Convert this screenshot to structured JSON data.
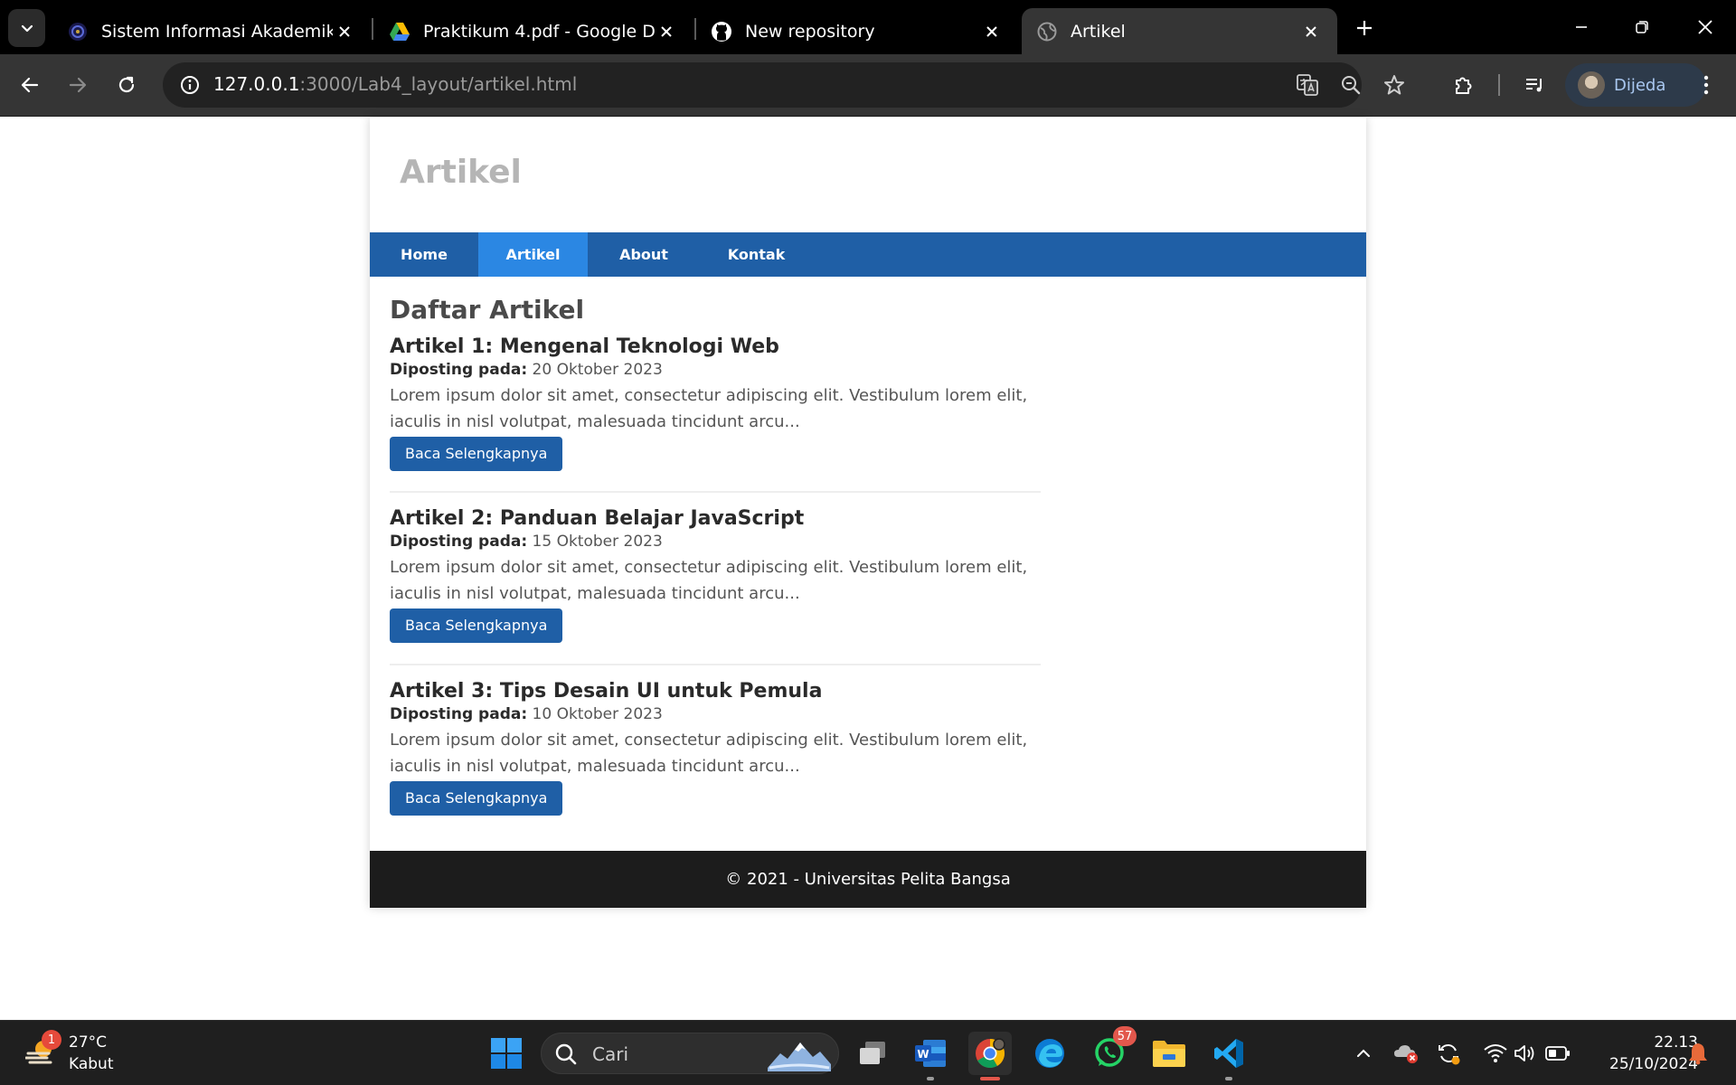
{
  "browser": {
    "tabs": [
      {
        "title": "Sistem Informasi Akademik",
        "active": false
      },
      {
        "title": "Praktikum 4.pdf - Google Drive",
        "active": false
      },
      {
        "title": "New repository",
        "active": false
      },
      {
        "title": "Artikel",
        "active": true
      }
    ],
    "url_host": "127.0.0.1",
    "url_rest": ":3000/Lab4_layout/artikel.html",
    "profile_name": "Dijeda"
  },
  "site": {
    "title": "Artikel",
    "nav": [
      {
        "label": "Home",
        "active": false
      },
      {
        "label": "Artikel",
        "active": true
      },
      {
        "label": "About",
        "active": false
      },
      {
        "label": "Kontak",
        "active": false
      }
    ],
    "content_title": "Daftar Artikel",
    "date_label": "Diposting pada:",
    "articles": [
      {
        "title": "Artikel 1: Mengenal Teknologi Web",
        "date": "20 Oktober 2023",
        "excerpt": "Lorem ipsum dolor sit amet, consectetur adipiscing elit. Vestibulum lorem elit, iaculis in nisl volutpat, malesuada tincidunt arcu...",
        "button": "Baca Selengkapnya"
      },
      {
        "title": "Artikel 2: Panduan Belajar JavaScript",
        "date": "15 Oktober 2023",
        "excerpt": "Lorem ipsum dolor sit amet, consectetur adipiscing elit. Vestibulum lorem elit, iaculis in nisl volutpat, malesuada tincidunt arcu...",
        "button": "Baca Selengkapnya"
      },
      {
        "title": "Artikel 3: Tips Desain UI untuk Pemula",
        "date": "10 Oktober 2023",
        "excerpt": "Lorem ipsum dolor sit amet, consectetur adipiscing elit. Vestibulum lorem elit, iaculis in nisl volutpat, malesuada tincidunt arcu...",
        "button": "Baca Selengkapnya"
      }
    ],
    "footer": "© 2021 - Universitas Pelita Bangsa",
    "colors": {
      "nav": "#1f5fa6",
      "nav_active": "#2b87e3",
      "footer": "#1c1c1c"
    }
  },
  "taskbar": {
    "weather_temp": "27°C",
    "weather_cond": "Kabut",
    "weather_badge": "1",
    "search_placeholder": "Cari",
    "whatsapp_badge": "57",
    "time": "22.13",
    "date": "25/10/2024"
  }
}
